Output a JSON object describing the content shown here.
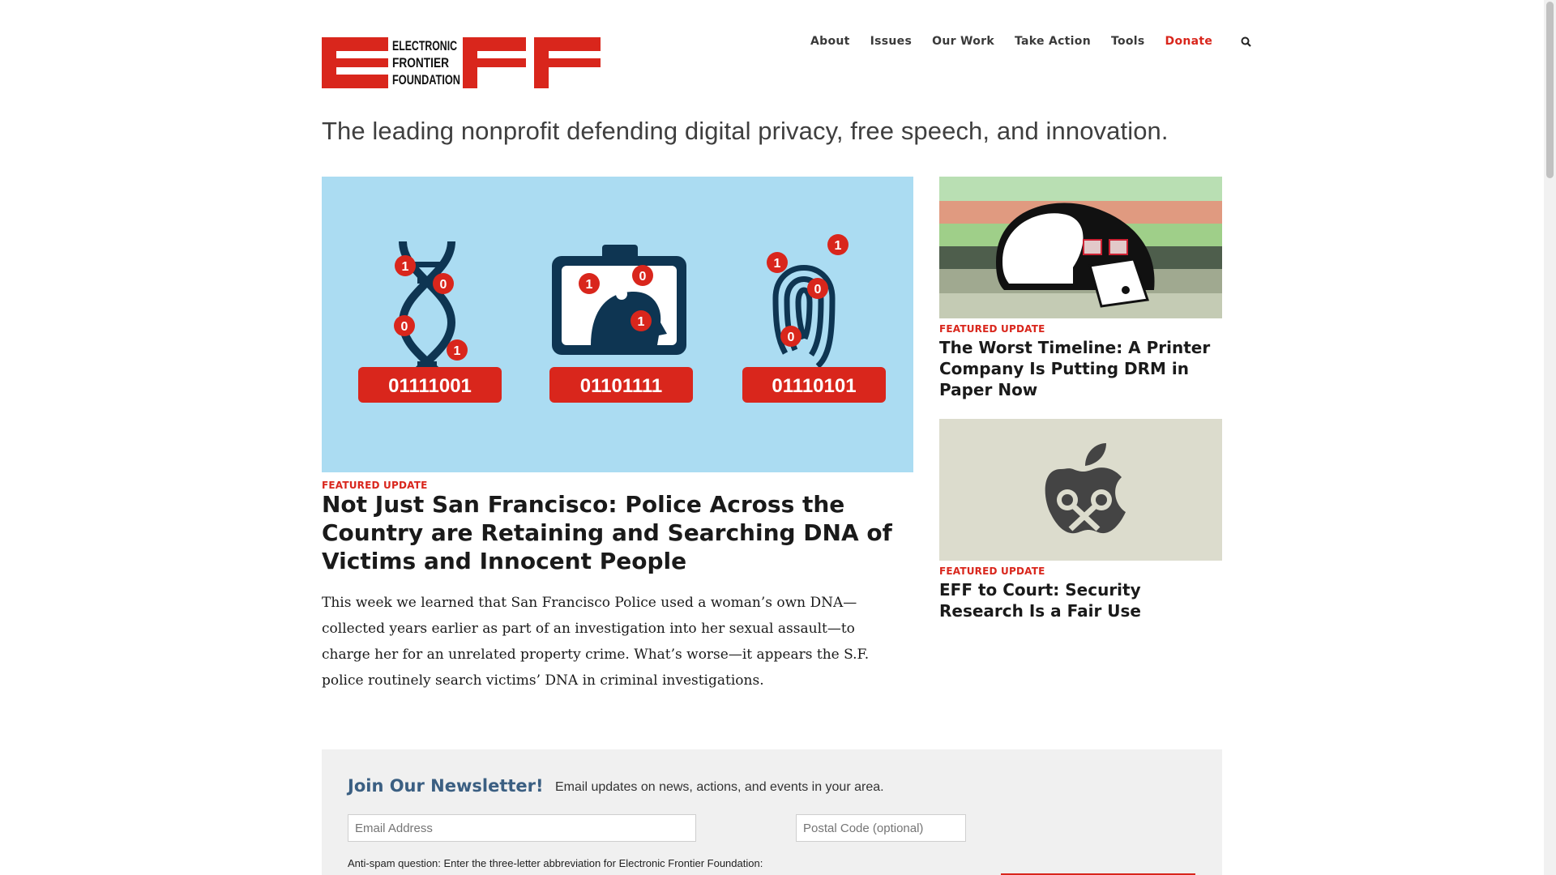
{
  "header": {
    "logo_text": [
      "ELECTRONIC",
      "FRONTIER",
      "FOUNDATION"
    ],
    "nav": [
      "About",
      "Issues",
      "Our Work",
      "Take Action",
      "Tools",
      "Donate"
    ]
  },
  "tagline": "The leading nonprofit defending digital privacy, free speech, and innovation.",
  "main_story": {
    "image_labels": [
      "01111001",
      "01101111",
      "01110101"
    ],
    "kicker": "FEATURED UPDATE",
    "title": "Not Just San Francisco: Police Across the Country are Retaining and Searching DNA of Victims and Innocent People",
    "excerpt": "This week we learned that San Francisco Police used a woman’s own DNA—collected years earlier as part of an investigation into her sexual assault—to charge her for an unrelated property crime. What’s worse—it appears the S.F. police routinely search victims’ DNA in criminal investigations."
  },
  "side_stories": [
    {
      "kicker": "FEATURED UPDATE",
      "title": "The Worst Timeline: A Printer Company Is Putting DRM in Paper Now"
    },
    {
      "kicker": "FEATURED UPDATE",
      "title": "EFF to Court: Security Research Is a Fair Use"
    }
  ],
  "newsletter": {
    "title": "Join Our Newsletter!",
    "subtitle": "Email updates on news, actions, and events in your area.",
    "email_placeholder": "Email Address",
    "postal_placeholder": "Postal Code (optional)",
    "antispam": "Anti-spam question: Enter the three-letter abbreviation for Electronic Frontier Foundation:"
  },
  "colors": {
    "brand_red": "#d9261c",
    "hero_bg": "#abdcf2",
    "navy": "#0e3552",
    "newsletter_title": "#3b5f82"
  }
}
